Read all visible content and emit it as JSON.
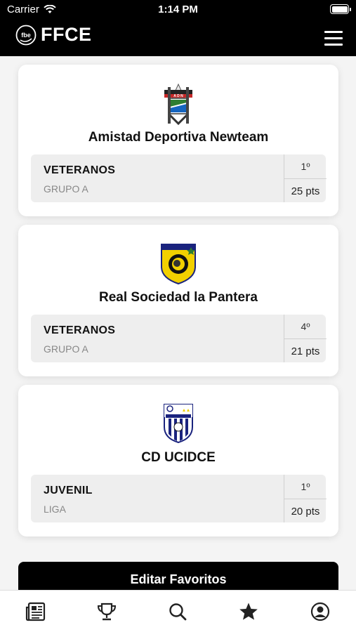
{
  "status_bar": {
    "carrier": "Carrier",
    "time": "1:14 PM"
  },
  "header": {
    "logo_text": "fbe",
    "app_name": "FFCE"
  },
  "favorites": [
    {
      "team": "Amistad Deportiva Newteam",
      "category": "VETERANOS",
      "group": "GRUPO A",
      "rank": "1º",
      "points": "25 pts",
      "crest": "newteam-crest-icon"
    },
    {
      "team": "Real Sociedad la Pantera",
      "category": "VETERANOS",
      "group": "GRUPO A",
      "rank": "4º",
      "points": "21 pts",
      "crest": "pantera-crest-icon"
    },
    {
      "team": "CD UCIDCE",
      "category": "JUVENIL",
      "group": "LIGA",
      "rank": "1º",
      "points": "20 pts",
      "crest": "ucidce-crest-icon"
    }
  ],
  "actions": {
    "edit_favorites": "Editar Favoritos"
  },
  "tab_bar": [
    "news-icon",
    "trophy-icon",
    "search-icon",
    "star-icon",
    "profile-icon"
  ],
  "colors": {
    "header_bg": "#000000",
    "card_bg": "#ffffff",
    "stat_bg": "#eeeeee",
    "active_tab": "#222222"
  }
}
